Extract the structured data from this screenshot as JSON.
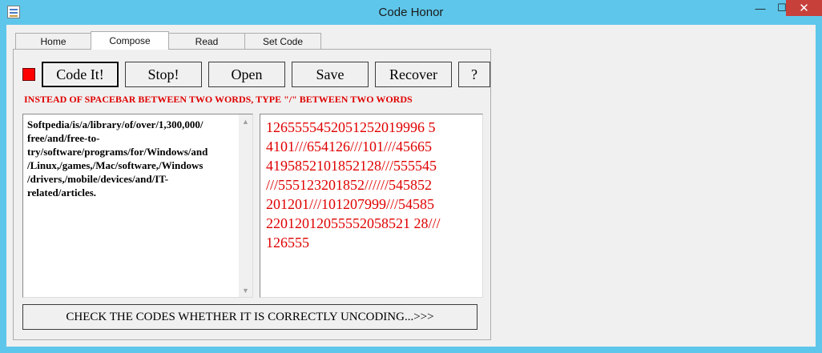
{
  "window": {
    "title": "Code Honor",
    "min_glyph": "—",
    "max_glyph": "☐",
    "close_glyph": "✕"
  },
  "tabs": [
    {
      "label": "Home",
      "active": false
    },
    {
      "label": "Compose",
      "active": true
    },
    {
      "label": "Read",
      "active": false
    },
    {
      "label": "Set Code",
      "active": false
    }
  ],
  "toolbar": {
    "indicator_color": "#ff0000",
    "code_it_label": "Code It!",
    "stop_label": "Stop!",
    "open_label": "Open",
    "save_label": "Save",
    "recover_label": "Recover",
    "help_label": "?"
  },
  "hint": "INSTEAD OF SPACEBAR BETWEEN TWO WORDS, TYPE \"/\" BETWEEN TWO WORDS",
  "input_text": "Softpedia/is/a/library/of/over/1,300,000/free/and/free-to-try/software/programs/for/Windows/and/Linux,/games,/Mac/software,/Windows/drivers,/mobile/devices/and/IT-related/articles.",
  "input_lines": [
    "Softpedia/is/a/library/of/over/1,300,000/",
    "free/and/free-to-",
    "try/software/programs/for/Windows/and",
    "/Linux,/games,/Mac/software,/Windows",
    "/drivers,/mobile/devices/and/IT-",
    "related/articles."
  ],
  "output_lines": [
    "1265555452051252019996 5",
    "4101///654126///101///45665",
    "4195852101852128///555545",
    "///555123201852//////545852",
    "201201///101207999///54585",
    "22012012055552058521 28///",
    "126555"
  ],
  "check_button_label": "CHECK THE CODES WHETHER IT IS CORRECTLY UNCODING...>>>",
  "colors": {
    "accent_red": "#e00000",
    "titlebar": "#5ec6ea",
    "close_button": "#c7403a"
  }
}
